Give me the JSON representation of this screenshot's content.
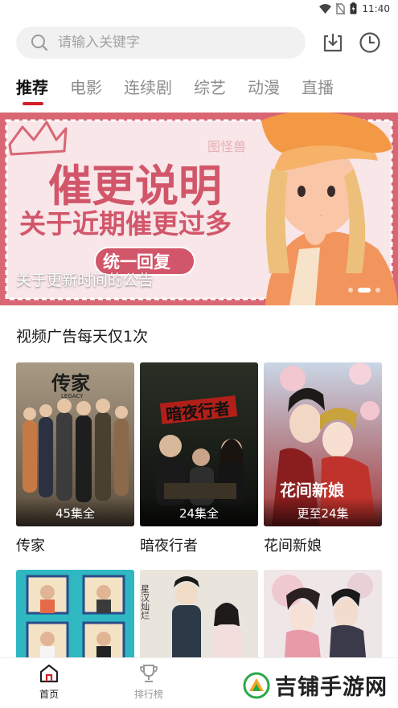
{
  "status_bar": {
    "time": "11:40"
  },
  "search": {
    "placeholder": "请输入关键字"
  },
  "tabs": [
    {
      "label": "推荐",
      "active": true
    },
    {
      "label": "电影"
    },
    {
      "label": "连续剧"
    },
    {
      "label": "综艺"
    },
    {
      "label": "动漫"
    },
    {
      "label": "直播"
    }
  ],
  "banner": {
    "caption": "关于更新时间的公告",
    "headline": "催更说明",
    "subline": "关于近期催更过多",
    "pill": "统一回复",
    "watermark": "图怪兽",
    "slide_count": 3,
    "active_slide": 2
  },
  "section": {
    "title": "视频广告每天仅1次"
  },
  "videos": [
    {
      "title": "传家",
      "badge": "45集全",
      "poster_text": "传家",
      "poster_subtext": "LEGACY"
    },
    {
      "title": "暗夜行者",
      "badge": "24集全",
      "poster_text": "暗夜行者"
    },
    {
      "title": "花间新娘",
      "badge": "更至24集",
      "poster_text": "花间新娘"
    },
    {
      "title": "",
      "badge": ""
    },
    {
      "title": "",
      "badge": "",
      "poster_text": "星汉灿烂"
    },
    {
      "title": "",
      "badge": ""
    }
  ],
  "bottom_nav": [
    {
      "label": "首页",
      "icon": "home-icon",
      "active": true
    },
    {
      "label": "排行榜",
      "icon": "trophy-icon"
    }
  ],
  "watermark": {
    "text": "吉铺手游网"
  },
  "colors": {
    "accent": "#d0202a",
    "banner_bg": "#d86673",
    "tab_inactive": "#8e8e8e"
  }
}
